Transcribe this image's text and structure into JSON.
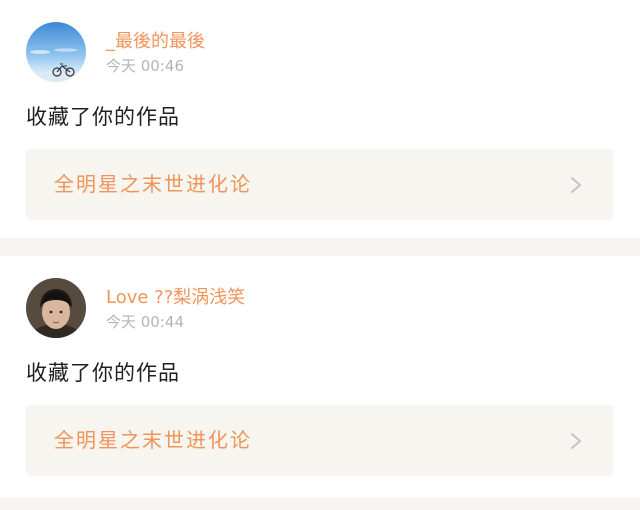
{
  "feed": {
    "items": [
      {
        "user": {
          "name": "_最後的最後",
          "avatar_icon": "landscape-avatar-with-bicycle"
        },
        "time": "今天 00:46",
        "action": "收藏了你的作品",
        "work": {
          "title": "全明星之末世进化论",
          "chevron_icon": "chevron-right-icon"
        }
      },
      {
        "user": {
          "name": "Love ??梨涡浅笑",
          "avatar_icon": "person-avatar-photo"
        },
        "time": "今天 00:44",
        "action": "收藏了你的作品",
        "work": {
          "title": "全明星之末世进化论",
          "chevron_icon": "chevron-right-icon"
        }
      }
    ]
  },
  "colors": {
    "accent_orange": "#f0945a",
    "timestamp_gray": "#b4b4b4",
    "card_background": "#ffffff",
    "work_box_background": "#f6f5ef",
    "page_background": "#f6f5f4",
    "chevron_gray": "#c4c4c4"
  }
}
